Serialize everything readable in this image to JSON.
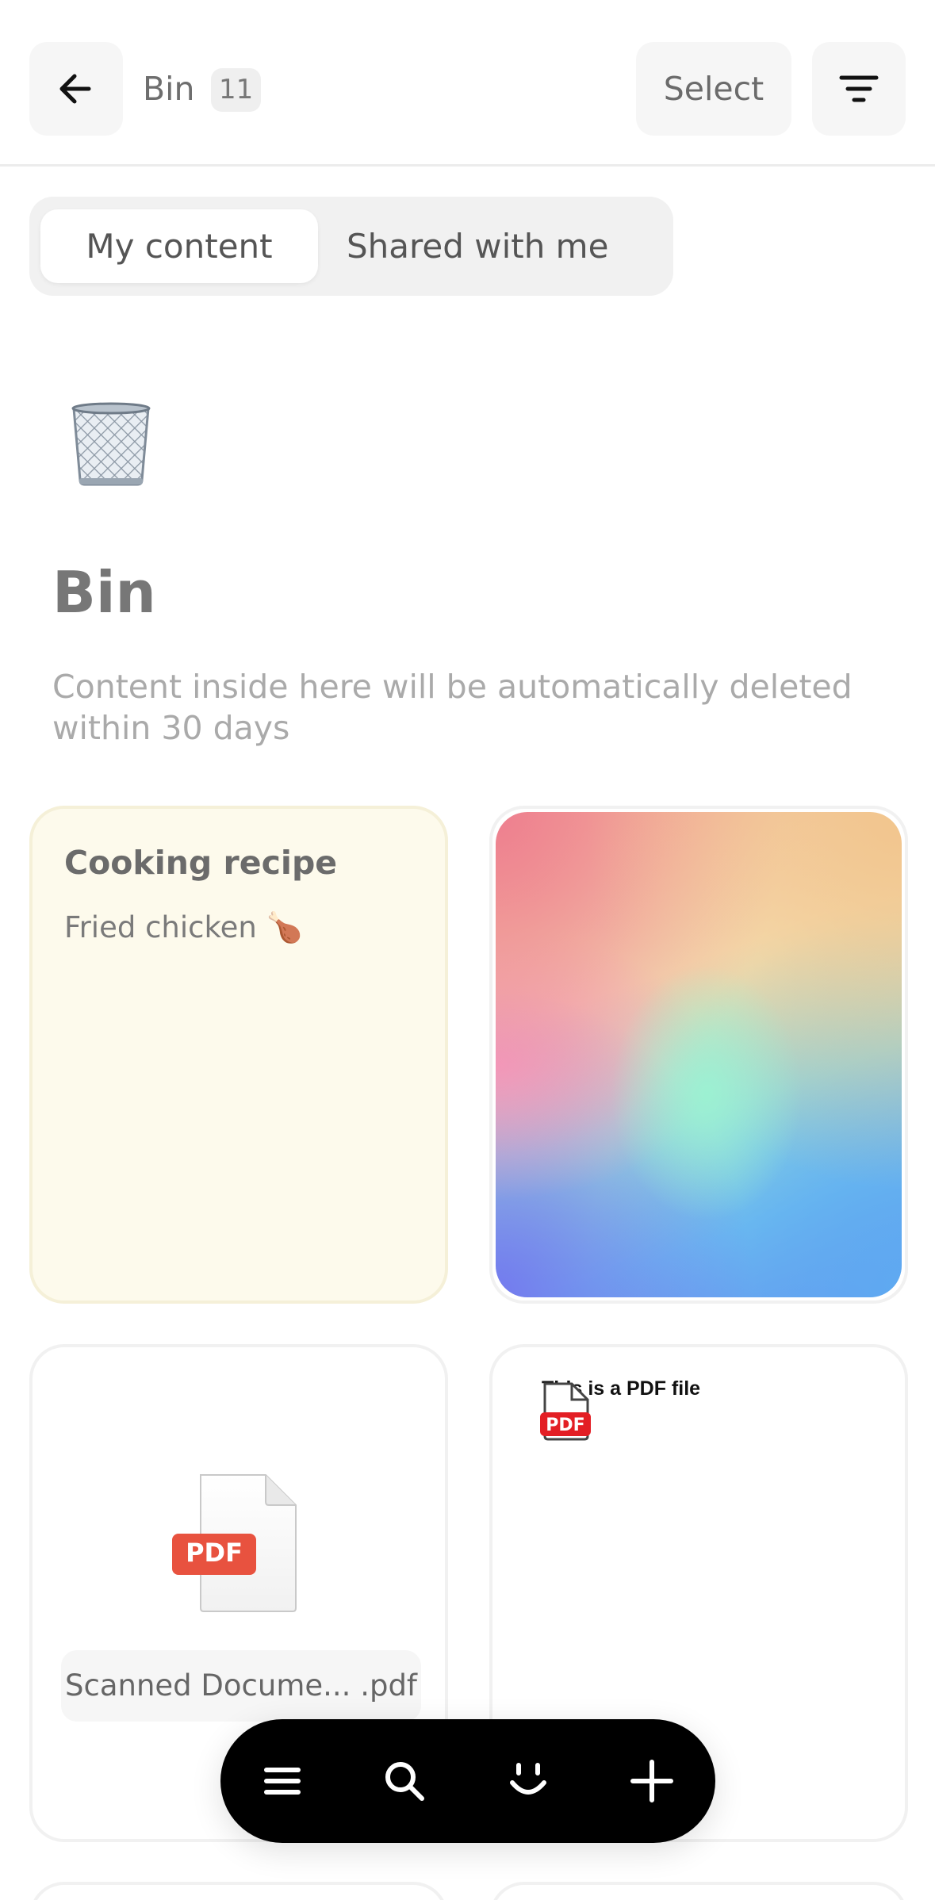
{
  "header": {
    "title": "Bin",
    "count": "11",
    "select_label": "Select",
    "back_icon": "arrow-left-icon",
    "filter_icon": "filter-icon"
  },
  "tabs": [
    {
      "label": "My content",
      "active": true
    },
    {
      "label": "Shared with me",
      "active": false
    }
  ],
  "hero": {
    "icon": "wastebasket-icon",
    "title": "Bin",
    "description": "Content inside here will be automatically deleted within 30 days"
  },
  "cards": {
    "note": {
      "title": "Cooking recipe",
      "body": "Fried chicken 🍗"
    },
    "gradient": {
      "type": "image"
    },
    "pdf": {
      "badge": "PDF",
      "filename": "Scanned Docume... .pdf"
    },
    "pdf_preview": {
      "text": "This is a PDF file",
      "badge": "PDF"
    }
  },
  "tabbar": {
    "items": [
      "menu-icon",
      "search-icon",
      "smile-icon",
      "plus-icon"
    ]
  },
  "colors": {
    "note_bg": "#fdfaec",
    "pdf_red": "#e8523f",
    "tabbar_bg": "#000000"
  }
}
